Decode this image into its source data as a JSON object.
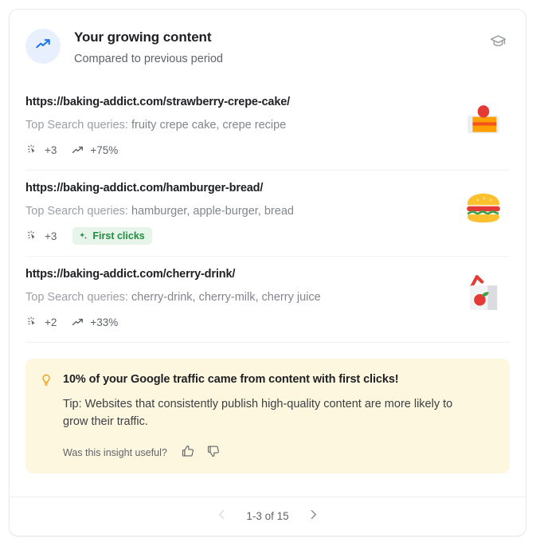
{
  "header": {
    "title": "Your growing content",
    "subtitle": "Compared to previous period",
    "trend_icon": "trending-up-icon",
    "action_icon": "graduation-cap-icon"
  },
  "items": [
    {
      "url": "https://baking-addict.com/strawberry-crepe-cake/",
      "queries_label": "Top Search queries:",
      "queries_values": "fruity crepe cake, crepe recipe",
      "clicks_icon": "first-clicks-cursor-icon",
      "clicks_value": "+3",
      "trend_icon": "trending-up-icon",
      "trend_value": "+75%",
      "chip_label": null,
      "thumbnail": "cake-slice-emoji"
    },
    {
      "url": "https://baking-addict.com/hamburger-bread/",
      "queries_label": "Top Search queries:",
      "queries_values": "hamburger, apple-burger, bread",
      "clicks_icon": "first-clicks-cursor-icon",
      "clicks_value": "+3",
      "trend_icon": null,
      "trend_value": null,
      "chip_label": "First clicks",
      "chip_icon": "sparkle-icon",
      "thumbnail": "hamburger-emoji"
    },
    {
      "url": "https://baking-addict.com/cherry-drink/",
      "queries_label": "Top Search queries:",
      "queries_values": "cherry-drink, cherry-milk, cherry juice",
      "clicks_icon": "first-clicks-cursor-icon",
      "clicks_value": "+2",
      "trend_icon": "trending-up-icon",
      "trend_value": "+33%",
      "chip_label": null,
      "thumbnail": "juice-box-emoji"
    }
  ],
  "insight": {
    "icon": "lightbulb-icon",
    "headline": "10% of your Google traffic came from content with first clicks!",
    "tip": "Tip: Websites that consistently publish high-quality content are more likely to grow their traffic.",
    "feedback_label": "Was this insight useful?",
    "thumbs_up_icon": "thumb-up-icon",
    "thumbs_down_icon": "thumb-down-icon"
  },
  "footer": {
    "prev_icon": "chevron-left-icon",
    "range_label": "1-3 of 15",
    "next_icon": "chevron-right-icon"
  },
  "colors": {
    "accent_blue": "#1a73e8",
    "badge_bg": "#e8f0fe",
    "chip_bg": "#e6f4ea",
    "chip_text": "#1e8e3e",
    "insight_bg": "#fef7e0",
    "bulb_orange": "#f29900",
    "card_border": "#e8eaed",
    "text_primary": "#202124",
    "text_secondary": "#5f6368",
    "text_muted": "#9aa0a6"
  }
}
